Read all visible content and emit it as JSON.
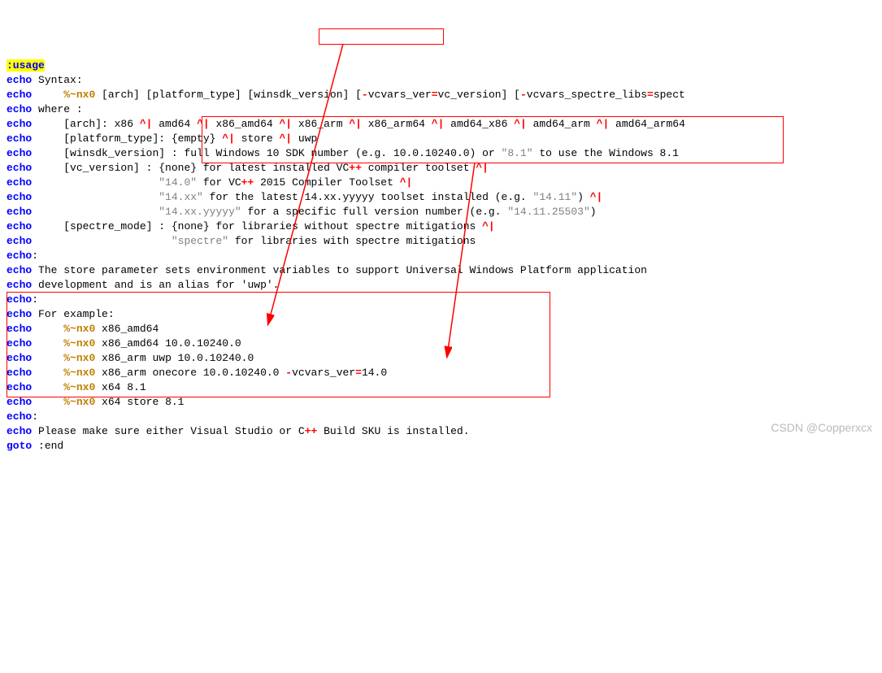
{
  "label": ":usage",
  "kw_echo": "echo",
  "kw_goto": "goto",
  "l1": " Syntax:",
  "l2_a": "     ",
  "l2_var": "%~nx0",
  "l2_b": " [arch] [platform_type] [winsdk_version] [",
  "l2_sym1": "-",
  "l2_c": "vcvars_ver",
  "l2_sym2": "=",
  "l2_d": "vc_version] [",
  "l2_sym3": "-",
  "l2_e": "vcvars_spectre_libs",
  "l2_sym4": "=",
  "l2_f": "spect",
  "l3": " where :",
  "l4_a": "     [arch]: x86 ",
  "caret_pipe": "^|",
  "l4_b": " amd64 ",
  "l4_c": " x86_amd64 ",
  "l4_d": " x86_arm ",
  "l4_e": " x86_arm64 ",
  "l4_f": " amd64_x86 ",
  "l4_g": " amd64_arm ",
  "l4_h": " amd64_arm64",
  "l5_a": "     [platform_type]: {empty} ",
  "l5_b": " store ",
  "l5_c": " uwp",
  "l6_a": "     [winsdk_version] : full Windows 10 SDK number (e.g. 10.0.10240.0) or ",
  "l6_s1": "\"8.1\"",
  "l6_b": " to use the Windows 8.1",
  "l7_a": "     [vc_version] : {none} for latest installed VC",
  "l7_sym": "++",
  "l7_b": " compiler toolset ",
  "l8_a": "                    ",
  "l8_s1": "\"14.0\"",
  "l8_b": " for VC",
  "l8_sym": "++",
  "l8_c": " 2015 Compiler Toolset ",
  "l9_a": "                    ",
  "l9_s1": "\"14.xx\"",
  "l9_b": " for the latest 14.xx.yyyyy toolset installed (e.g. ",
  "l9_s2": "\"14.11\"",
  "l9_c": ") ",
  "l10_a": "                    ",
  "l10_s1": "\"14.xx.yyyyy\"",
  "l10_b": " for a specific full version number (e.g. ",
  "l10_s2": "\"14.11.25503\"",
  "l10_c": ")",
  "l11_a": "     [spectre_mode] : {none} for libraries without spectre mitigations ",
  "l12_a": "                      ",
  "l12_s1": "\"spectre\"",
  "l12_b": " for libraries with spectre mitigations",
  "l13": ":",
  "l14": " The store parameter sets environment variables to support Universal Windows Platform application",
  "l15": " development and is an alias for 'uwp'.",
  "l16": " For example:",
  "ex_var": "%~nx0",
  "ex_indent": "     ",
  "ex1": " x86_amd64",
  "ex2": " x86_amd64 10.0.10240.0",
  "ex3": " x86_arm uwp 10.0.10240.0",
  "ex4_a": " x86_arm onecore 10.0.10240.0 ",
  "ex4_sym1": "-",
  "ex4_b": "vcvars_ver",
  "ex4_sym2": "=",
  "ex4_c": "14.0",
  "ex5": " x64 8.1",
  "ex6": " x64 store 8.1",
  "l_end_a": " Please make sure either Visual Studio or C",
  "l_end_sym": "++",
  "l_end_b": " Build SKU is installed.",
  "goto_target": " :end",
  "watermark": "CSDN @Copperxcx"
}
